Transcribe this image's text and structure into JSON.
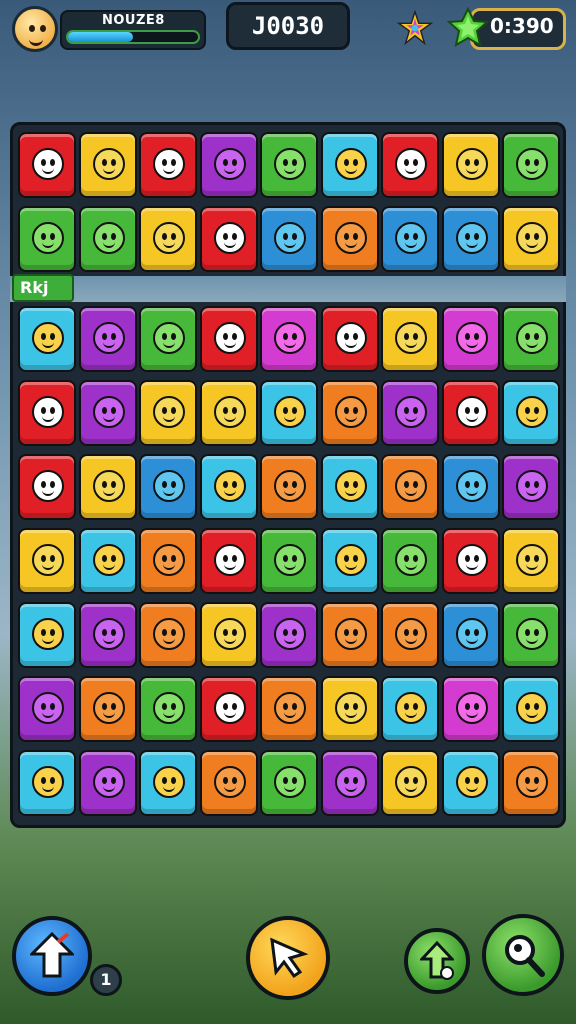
{
  "hud": {
    "player_name": "NOUZE8",
    "xp_progress": 0.5,
    "score": "J0030",
    "gems": "0:390"
  },
  "board": {
    "level_label": "Rkj",
    "colors": {
      "red": "#e11f26",
      "yellow": "#f6c624",
      "green": "#47b93a",
      "blue": "#2d8fd6",
      "cyan": "#3cc4e6",
      "purple": "#9d31c9",
      "magenta": "#d43bd0",
      "orange": "#f07d1f"
    },
    "top_rows": [
      [
        "red",
        "yellow",
        "red",
        "purple",
        "green",
        "cyan",
        "red",
        "yellow",
        "green"
      ],
      [
        "green",
        "green",
        "yellow",
        "red",
        "blue",
        "orange",
        "blue",
        "blue",
        "yellow"
      ]
    ],
    "main_rows": [
      [
        "cyan",
        "purple",
        "green",
        "red",
        "magenta",
        "red",
        "yellow",
        "magenta",
        "green"
      ],
      [
        "red",
        "purple",
        "yellow",
        "yellow",
        "cyan",
        "orange",
        "purple",
        "red",
        "cyan"
      ],
      [
        "red",
        "yellow",
        "blue",
        "cyan",
        "orange",
        "cyan",
        "orange",
        "blue",
        "purple"
      ],
      [
        "yellow",
        "cyan",
        "orange",
        "red",
        "green",
        "cyan",
        "green",
        "red",
        "yellow"
      ],
      [
        "cyan",
        "purple",
        "orange",
        "yellow",
        "purple",
        "orange",
        "orange",
        "blue",
        "green"
      ],
      [
        "purple",
        "orange",
        "green",
        "red",
        "orange",
        "yellow",
        "cyan",
        "magenta",
        "cyan"
      ],
      [
        "cyan",
        "purple",
        "cyan",
        "orange",
        "green",
        "purple",
        "yellow",
        "cyan",
        "orange"
      ]
    ]
  },
  "controls": {
    "booster_count": "1"
  }
}
